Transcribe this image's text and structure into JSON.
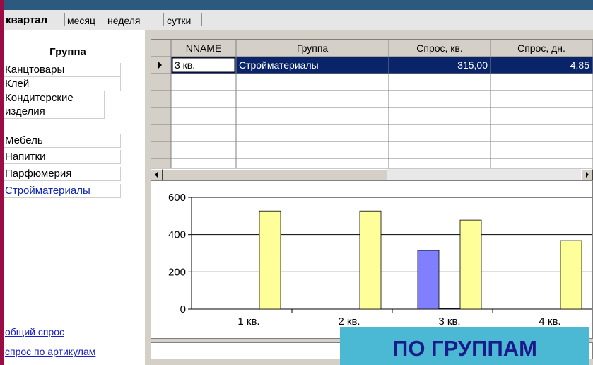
{
  "tabs": [
    {
      "label": "квартал",
      "active": true
    },
    {
      "label": "месяц",
      "active": false
    },
    {
      "label": "неделя",
      "active": false
    },
    {
      "label": "сутки",
      "active": false
    }
  ],
  "sidebar": {
    "title": "Группа",
    "items": [
      {
        "label": "Канцтовары",
        "selected": false
      },
      {
        "label": "Клей",
        "selected": false
      },
      {
        "label": "Кондитерские изделия",
        "selected": false
      },
      {
        "label": "Мебель",
        "selected": false
      },
      {
        "label": "Напитки",
        "selected": false
      },
      {
        "label": "Парфюмерия",
        "selected": false
      },
      {
        "label": "Стройматериалы",
        "selected": true
      }
    ],
    "links": [
      "общий спрос",
      "спрос по артикулам"
    ]
  },
  "grid": {
    "columns": [
      "NNAME",
      "Группа",
      "Спрос, кв.",
      "Спрос, дн."
    ],
    "rows": [
      [
        "3 кв.",
        "Стройматериалы",
        "315,00",
        "4,85"
      ]
    ],
    "empty_rows": 6
  },
  "chart_data": {
    "type": "bar",
    "categories": [
      "1 кв.",
      "2 кв.",
      "3 кв.",
      "4 кв."
    ],
    "series": [
      {
        "values": [
          0,
          0,
          315,
          0
        ],
        "color": "#8080ff"
      },
      {
        "values": [
          0,
          0,
          5,
          0
        ],
        "color": "#1a1a4a"
      },
      {
        "values": [
          527,
          527,
          478,
          368
        ],
        "color": "#ffff99"
      }
    ],
    "ylim": [
      0,
      600
    ],
    "yticks": [
      "0",
      "200",
      "400",
      "600"
    ],
    "grid": true
  },
  "badge": {
    "text": "ПО ГРУППАМ"
  },
  "colors": {
    "background": "#9c0c44",
    "selection": "#0a246a",
    "link": "#1a20c8",
    "badge_bg": "#4bb8d4",
    "badge_text": "#1a1a8a"
  }
}
